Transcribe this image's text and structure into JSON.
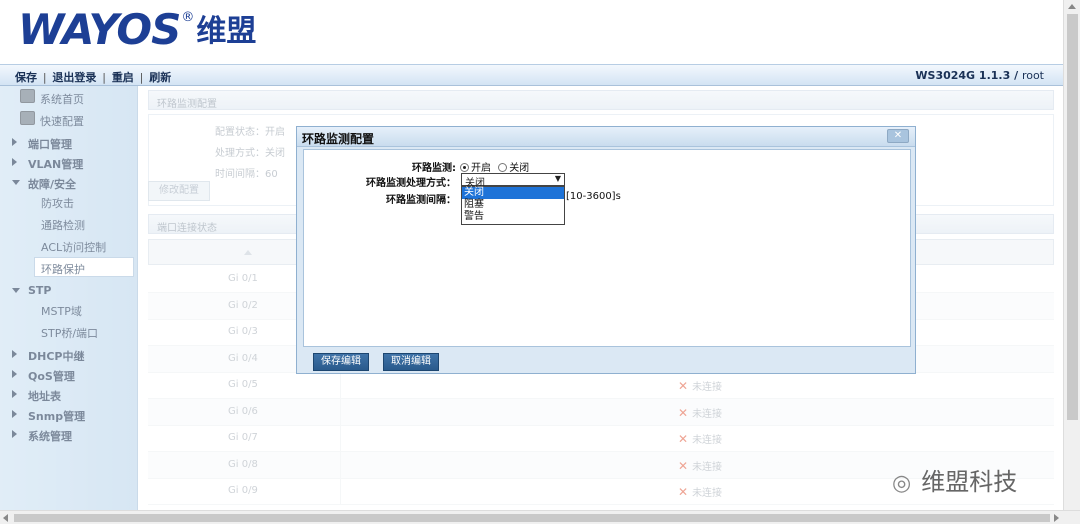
{
  "logo": {
    "brand": "WAYOS",
    "reg": "®",
    "cn": "维盟"
  },
  "toolbar": {
    "save": "保存",
    "logout": "退出登录",
    "reboot": "重启",
    "refresh": "刷新",
    "sep": "|",
    "version": "WS3024G 1.1.3 /",
    "user": "root"
  },
  "sidebar": {
    "home": "系统首页",
    "quick": "快速配置",
    "port_mgmt": "端口管理",
    "vlan_mgmt": "VLAN管理",
    "fault_security": "故障/安全",
    "anti_attack": "防攻击",
    "path_detect": "通路检测",
    "acl": "ACL访问控制",
    "loop_protect": "环路保护",
    "stp": "STP",
    "mstp": "MSTP域",
    "stp_bridge": "STP桥/端口",
    "dhcp_relay": "DHCP中继",
    "qos": "QoS管理",
    "addr_table": "地址表",
    "snmp": "Snmp管理",
    "sys_mgmt": "系统管理"
  },
  "loop_config": {
    "title": "环路监测配置",
    "status_label": "配置状态：",
    "status_value": "开启",
    "method_label": "处理方式：",
    "method_value": "关闭",
    "interval_label": "时间间隔：",
    "interval_value": "60",
    "edit_button": "修改配置"
  },
  "port_status": {
    "title": "端口连接状态",
    "rows": [
      {
        "port": "Gi 0/1",
        "state": ""
      },
      {
        "port": "Gi 0/2",
        "state": ""
      },
      {
        "port": "Gi 0/3",
        "state": ""
      },
      {
        "port": "Gi 0/4",
        "state": ""
      },
      {
        "port": "Gi 0/5",
        "state": "未连接"
      },
      {
        "port": "Gi 0/6",
        "state": "未连接"
      },
      {
        "port": "Gi 0/7",
        "state": "未连接"
      },
      {
        "port": "Gi 0/8",
        "state": "未连接"
      },
      {
        "port": "Gi 0/9",
        "state": "未连接"
      }
    ],
    "x_mark": "✕"
  },
  "dialog": {
    "title": "环路监测配置",
    "close": "✕",
    "monitor_label": "环路监测:",
    "opt_on": "开启",
    "opt_off": "关闭",
    "method_label": "环路监测处理方式：",
    "method_selected": "关闭",
    "method_options": [
      "关闭",
      "阻塞",
      "警告"
    ],
    "interval_label": "环路监测间隔：",
    "interval_range": "[10-3600]s",
    "save_button": "保存编辑",
    "cancel_button": "取消编辑"
  },
  "watermark": {
    "text": "维盟科技"
  },
  "colors": {
    "brand": "#1d3f95",
    "sidebar": "#c0d9ee",
    "dialog_button": "#2f6396",
    "option_highlight": "#1e73d8"
  }
}
